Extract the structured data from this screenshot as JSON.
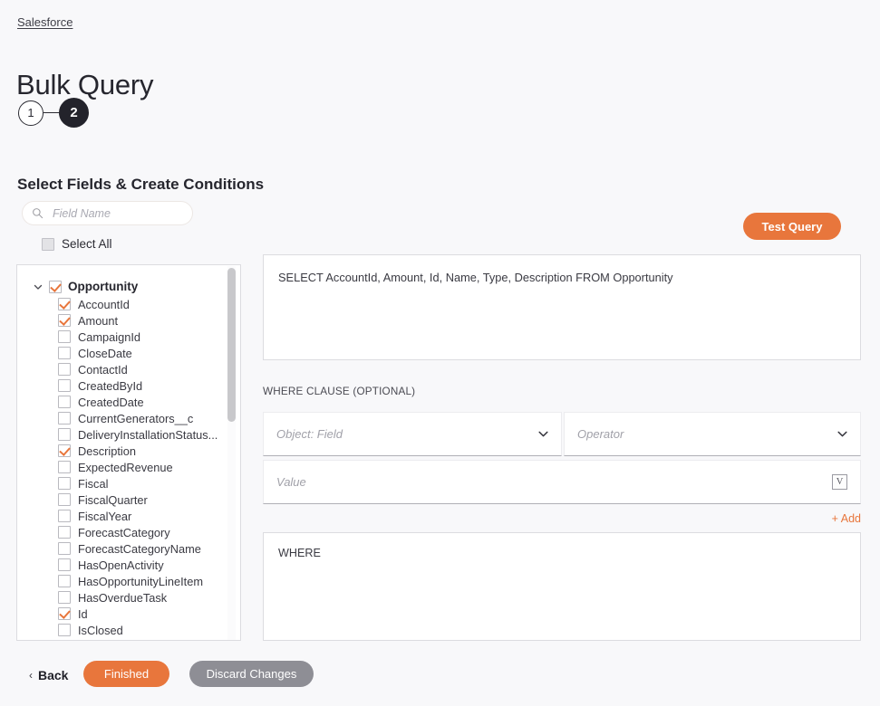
{
  "breadcrumb": {
    "label": "Salesforce"
  },
  "header": {
    "title": "Bulk Query"
  },
  "stepper": {
    "steps": [
      {
        "label": "1",
        "state": "inactive"
      },
      {
        "label": "2",
        "state": "active"
      }
    ]
  },
  "section": {
    "title": "Select Fields & Create Conditions"
  },
  "search": {
    "placeholder": "Field Name",
    "value": "",
    "icon": "search-icon"
  },
  "select_all": {
    "label": "Select All",
    "checked": false
  },
  "field_tree": {
    "root": {
      "label": "Opportunity",
      "checked": true,
      "expanded": true,
      "twisty": "chevron-down-icon"
    },
    "fields": [
      {
        "label": "AccountId",
        "checked": true
      },
      {
        "label": "Amount",
        "checked": true
      },
      {
        "label": "CampaignId",
        "checked": false
      },
      {
        "label": "CloseDate",
        "checked": false
      },
      {
        "label": "ContactId",
        "checked": false
      },
      {
        "label": "CreatedById",
        "checked": false
      },
      {
        "label": "CreatedDate",
        "checked": false
      },
      {
        "label": "CurrentGenerators__c",
        "checked": false
      },
      {
        "label": "DeliveryInstallationStatus...",
        "checked": false
      },
      {
        "label": "Description",
        "checked": true
      },
      {
        "label": "ExpectedRevenue",
        "checked": false
      },
      {
        "label": "Fiscal",
        "checked": false
      },
      {
        "label": "FiscalQuarter",
        "checked": false
      },
      {
        "label": "FiscalYear",
        "checked": false
      },
      {
        "label": "ForecastCategory",
        "checked": false
      },
      {
        "label": "ForecastCategoryName",
        "checked": false
      },
      {
        "label": "HasOpenActivity",
        "checked": false
      },
      {
        "label": "HasOpportunityLineItem",
        "checked": false
      },
      {
        "label": "HasOverdueTask",
        "checked": false
      },
      {
        "label": "Id",
        "checked": true
      },
      {
        "label": "IsClosed",
        "checked": false
      }
    ]
  },
  "toolbar": {
    "test_query_label": "Test Query"
  },
  "query": {
    "text": "SELECT AccountId, Amount, Id, Name, Type, Description FROM Opportunity"
  },
  "where_clause": {
    "label": "WHERE CLAUSE (OPTIONAL)",
    "object_field": {
      "placeholder": "Object: Field",
      "value": "",
      "icon": "chevron-down-icon"
    },
    "operator": {
      "placeholder": "Operator",
      "value": "",
      "icon": "chevron-down-icon"
    },
    "value": {
      "placeholder": "Value",
      "value": "",
      "icon": "variable-icon",
      "icon_glyph": "V"
    },
    "add_label": "+ Add"
  },
  "where_preview": {
    "text": "WHERE"
  },
  "footer": {
    "back_label": "Back",
    "back_chevron": "‹",
    "finished_label": "Finished",
    "discard_label": "Discard Changes"
  },
  "colors": {
    "accent_orange": "#e8763c",
    "gray_button": "#8e8e95",
    "page_bg": "#f8f8fa",
    "dark": "#23232b"
  }
}
